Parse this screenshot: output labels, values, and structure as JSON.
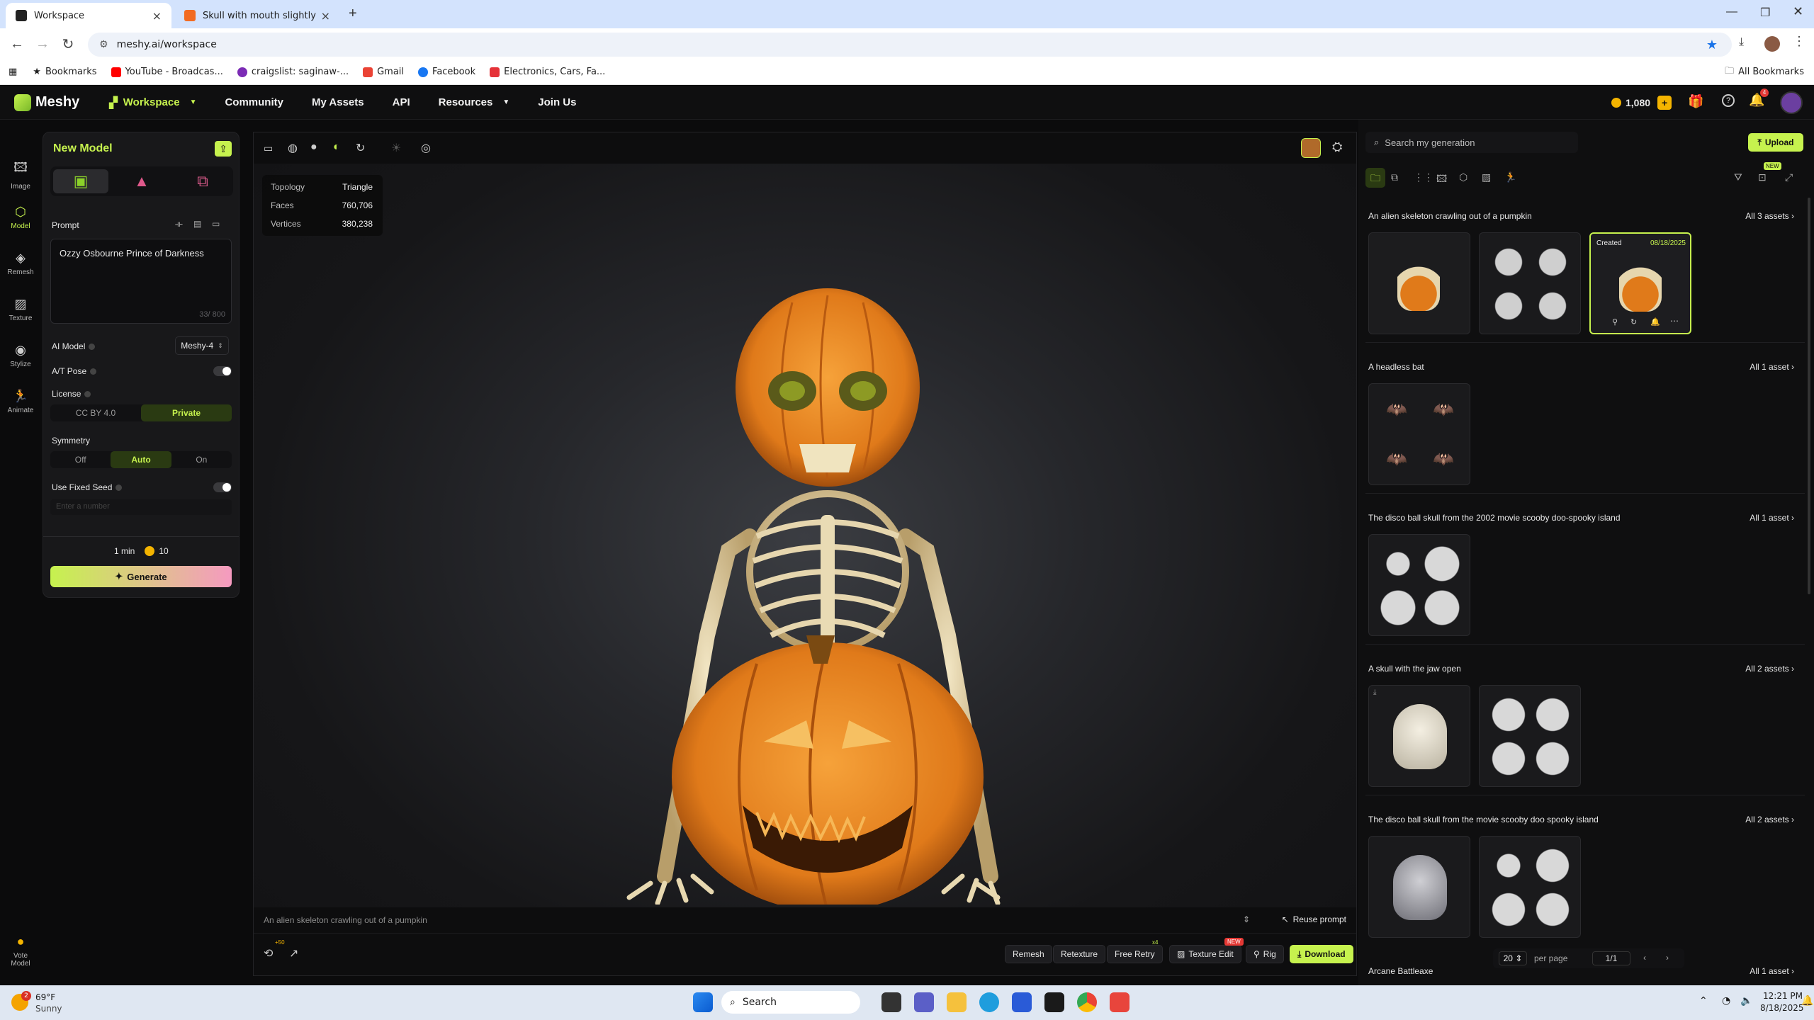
{
  "browser": {
    "tabs": [
      {
        "title": "Workspace",
        "active": true
      },
      {
        "title": "Skull with mouth slightly open",
        "active": false
      }
    ],
    "url": "meshy.ai/workspace",
    "bookmarks": [
      "Bookmarks",
      "YouTube - Broadcas...",
      "craigslist: saginaw-...",
      "Gmail",
      "Facebook",
      "Electronics, Cars, Fa..."
    ],
    "all_bookmarks": "All Bookmarks"
  },
  "app": {
    "logo": "Meshy",
    "nav": [
      "Workspace",
      "Community",
      "My Assets",
      "API",
      "Resources",
      "Join Us"
    ],
    "credits": "1,080",
    "notif_count": "4"
  },
  "rail": [
    {
      "label": "Image",
      "icon": "image-icon"
    },
    {
      "label": "Model",
      "icon": "cube-icon"
    },
    {
      "label": "Remesh",
      "icon": "remesh-icon"
    },
    {
      "label": "Texture",
      "icon": "texture-icon"
    },
    {
      "label": "Stylize",
      "icon": "stylize-icon"
    },
    {
      "label": "Animate",
      "icon": "animate-icon"
    }
  ],
  "vote": {
    "line1": "Vote",
    "line2": "Model"
  },
  "panel": {
    "title": "New Model",
    "prompt_label": "Prompt",
    "prompt_value": "Ozzy Osbourne Prince of Darkness",
    "char_count": "33/ 800",
    "ai_model_label": "AI Model",
    "ai_model_value": "Meshy-4",
    "atpose_label": "A/T Pose",
    "license_label": "License",
    "license_options": [
      "CC BY 4.0",
      "Private"
    ],
    "license_selected": "Private",
    "symmetry_label": "Symmetry",
    "symmetry_options": [
      "Off",
      "Auto",
      "On"
    ],
    "symmetry_selected": "Auto",
    "seed_label": "Use Fixed Seed",
    "seed_placeholder": "Enter a number",
    "time": "1 min",
    "cost": "10",
    "generate": "Generate"
  },
  "viewport": {
    "stats": [
      {
        "label": "Topology",
        "value": "Triangle"
      },
      {
        "label": "Faces",
        "value": "760,706"
      },
      {
        "label": "Vertices",
        "value": "380,238"
      }
    ],
    "prompt_text": "An alien skeleton crawling out of a pumpkin",
    "reuse": "Reuse prompt",
    "counter_badge": "+50",
    "actions": [
      "Remesh",
      "Retexture",
      "Free Retry",
      "Texture Edit",
      "Rig",
      "Download"
    ],
    "free_retry_badge": "x4",
    "texture_edit_badge": "NEW"
  },
  "right": {
    "search_placeholder": "Search my generation",
    "upload": "Upload",
    "new_badge": "NEW",
    "groups": [
      {
        "title": "An alien skeleton crawling out of a pumpkin",
        "all": "All 3 assets"
      },
      {
        "title": "A headless bat",
        "all": "All 1 asset"
      },
      {
        "title": "The disco ball skull from the 2002 movie scooby doo-spooky island",
        "all": "All 1 asset"
      },
      {
        "title": "A skull with the jaw open",
        "all": "All 2 assets"
      },
      {
        "title": "The disco ball skull from the movie scooby doo spooky island",
        "all": "All 2 assets"
      },
      {
        "title": "Arcane Battleaxe",
        "all": "All 1 asset"
      }
    ],
    "created_label": "Created",
    "created_date": "08/18/2025",
    "per_page_value": "20",
    "per_page_label": "per page",
    "page": "1/1"
  },
  "taskbar": {
    "weather_temp": "69°F",
    "weather_desc": "Sunny",
    "weather_badge": "2",
    "search": "Search",
    "time": "12:21 PM",
    "date": "8/18/2025"
  },
  "colors": {
    "accent": "#c6f24e",
    "gold": "#f4b400",
    "generate_from": "#c6f24e",
    "generate_to": "#f59ac0"
  }
}
